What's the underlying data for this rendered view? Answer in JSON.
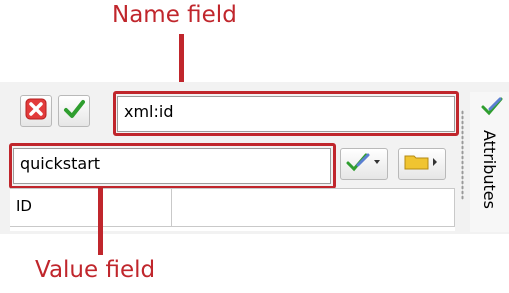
{
  "callouts": {
    "name_label": "Name field",
    "value_label": "Value field",
    "color": "#c0262c"
  },
  "toolbar": {
    "cancel_icon": "red-x-icon",
    "accept_icon": "green-check-icon",
    "name_value": "xml:id",
    "value_value": "quickstart",
    "edit_icon": "edit-check-dropdown-icon",
    "browse_icon": "folder-browse-icon"
  },
  "grid": {
    "columns": [
      "ID",
      ""
    ]
  },
  "side_panel": {
    "tab_label": "Attributes",
    "tab_icon": "attributes-check-icon"
  }
}
